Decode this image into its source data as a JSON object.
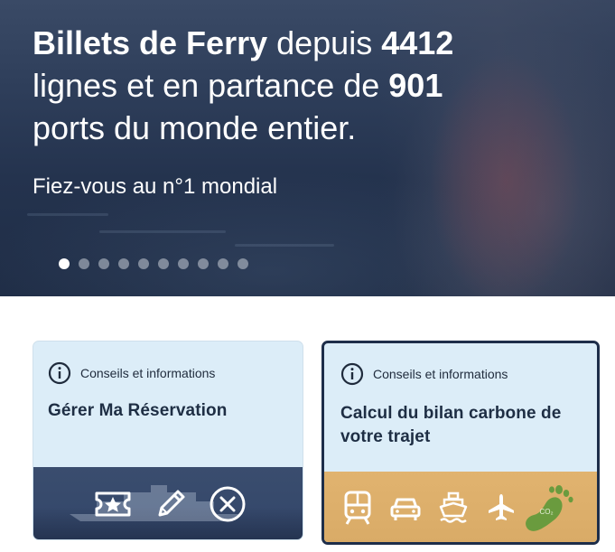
{
  "hero": {
    "headline": {
      "part1_bold": "Billets de Ferry",
      "part2": " depuis ",
      "part3_bold": "4412",
      "part4": "lignes et en partance de ",
      "part5_bold": "901",
      "part6": "ports du monde entier."
    },
    "tagline": "Fiez-vous au n°1 mondial",
    "carousel": {
      "total_slides": 10,
      "active_slide": 1
    }
  },
  "cards": [
    {
      "category": "Conseils et informations",
      "title": "Gérer Ma Réservation",
      "icons": [
        "ticket-star-icon",
        "pencil-icon",
        "cancel-circle-icon"
      ]
    },
    {
      "category": "Conseils et informations",
      "title": "Calcul du bilan carbone de votre trajet",
      "icons": [
        "train-icon",
        "car-icon",
        "ferry-icon",
        "plane-icon",
        "co2-footprint-icon"
      ],
      "co2_label": "CO₂"
    }
  ],
  "colors": {
    "hero_navy": "#24334e",
    "card_bg": "#dcedf8",
    "card_title": "#1e2e44",
    "carbon_panel": "#dcab67",
    "footprint_green": "#6a9b3e"
  }
}
